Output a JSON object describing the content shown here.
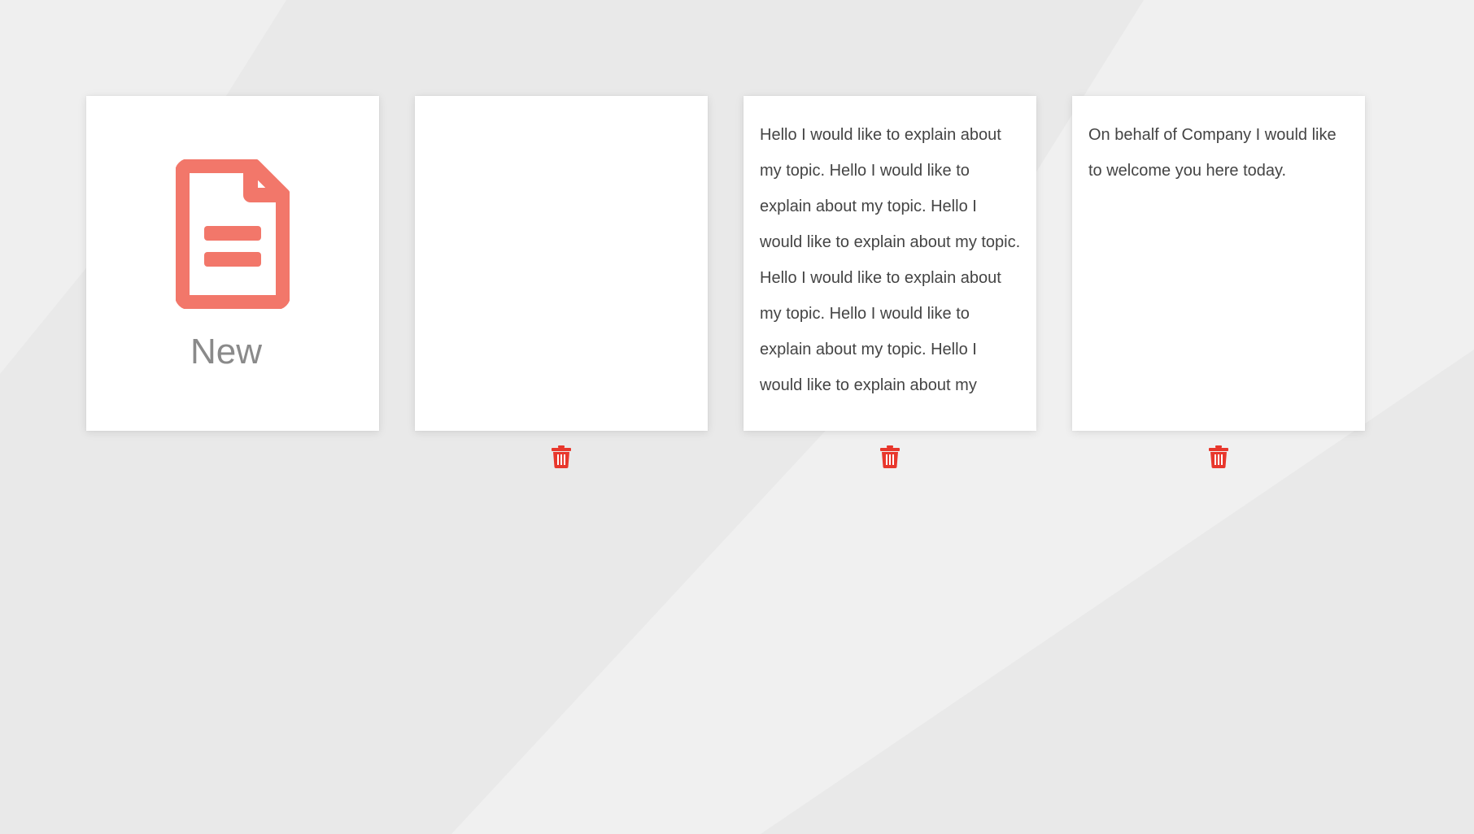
{
  "new_card": {
    "label": "New",
    "icon": "document-icon",
    "icon_color": "#f2776a"
  },
  "notes": [
    {
      "text": ""
    },
    {
      "text": "Hello I would like to explain about my topic. Hello I would like to explain about my topic. Hello I would like to explain about my topic. Hello I would like to explain about my topic. Hello I would like to explain about my topic. Hello I would like to explain about my"
    },
    {
      "text": "On behalf of Company I would like to welcome you here today."
    }
  ],
  "delete_icon": "trash-icon",
  "delete_color": "#e8372c",
  "background_color": "#e9e9e9"
}
